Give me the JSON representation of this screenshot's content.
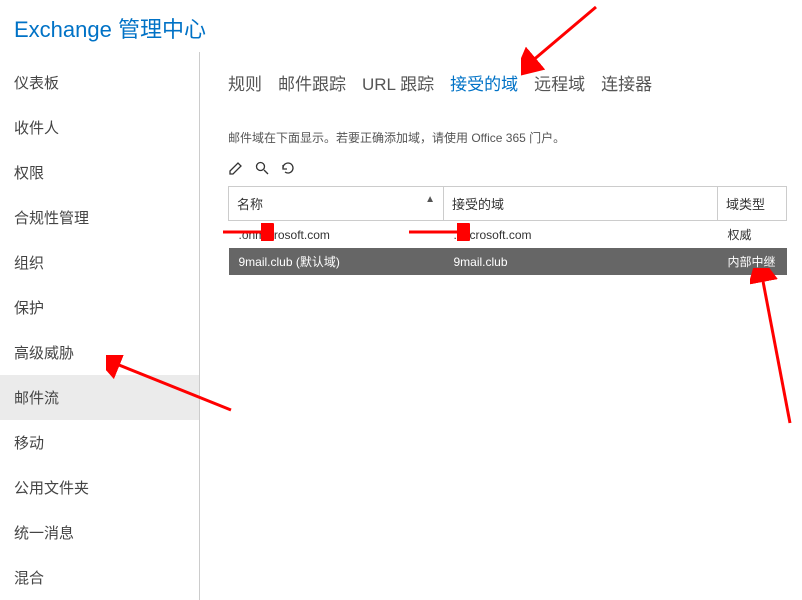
{
  "header": {
    "title": "Exchange 管理中心"
  },
  "sidebar": {
    "items": [
      {
        "label": "仪表板"
      },
      {
        "label": "收件人"
      },
      {
        "label": "权限"
      },
      {
        "label": "合规性管理"
      },
      {
        "label": "组织"
      },
      {
        "label": "保护"
      },
      {
        "label": "高级威胁"
      },
      {
        "label": "邮件流"
      },
      {
        "label": "移动"
      },
      {
        "label": "公用文件夹"
      },
      {
        "label": "统一消息"
      },
      {
        "label": "混合"
      }
    ],
    "activeIndex": 7
  },
  "tabs": {
    "items": [
      {
        "label": "规则"
      },
      {
        "label": "邮件跟踪"
      },
      {
        "label": "URL 跟踪"
      },
      {
        "label": "接受的域"
      },
      {
        "label": "远程域"
      },
      {
        "label": "连接器"
      }
    ],
    "activeIndex": 3
  },
  "help_text": "邮件域在下面显示。若要正确添加域，请使用 Office 365 门户。",
  "columns": {
    "name": "名称",
    "accepted": "接受的域",
    "type": "域类型"
  },
  "rows": [
    {
      "name": ".onmicrosoft.com",
      "accepted": ".microsoft.com",
      "type": "权威",
      "selected": false
    },
    {
      "name": "9mail.club (默认域)",
      "accepted": "9mail.club",
      "type": "内部中继",
      "selected": true
    }
  ],
  "colors": {
    "accent": "#0072c6",
    "selected_row": "#666666"
  }
}
